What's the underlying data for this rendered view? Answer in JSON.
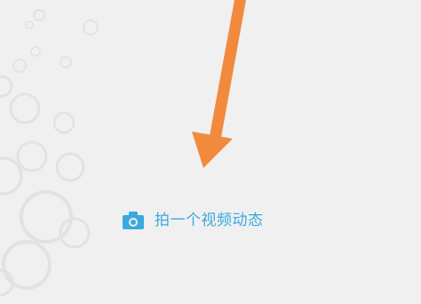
{
  "screen": {
    "background": "#f0f0f0",
    "annotation_color": "#f28a3d"
  },
  "action": {
    "label": "拍一个视频动态",
    "icon": "camera-icon",
    "color": "#39a9e0"
  }
}
